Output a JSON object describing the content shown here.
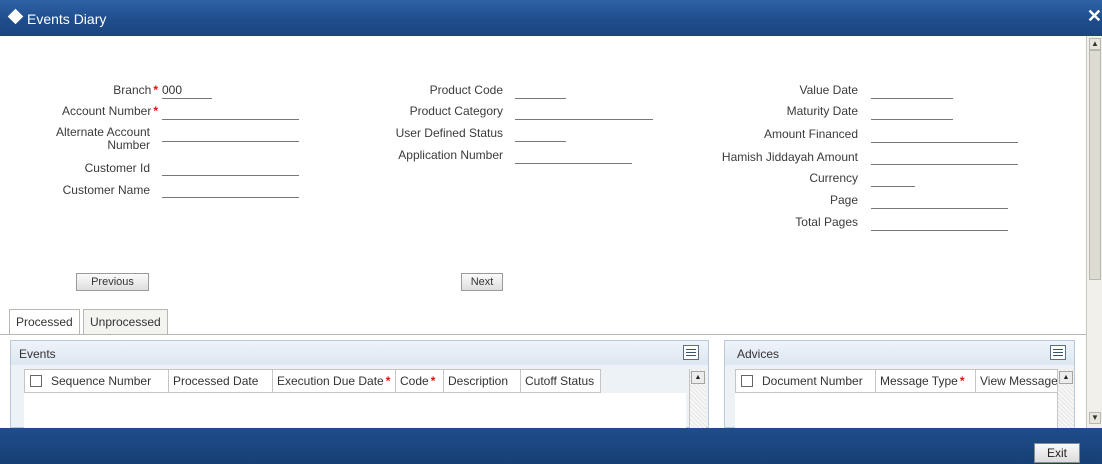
{
  "window": {
    "title": "Events Diary",
    "close_glyph": "✕"
  },
  "form": {
    "branch": {
      "label": "Branch",
      "required": "*",
      "value": "000"
    },
    "account_number": {
      "label": "Account Number",
      "required": "*",
      "value": ""
    },
    "alternate_account_number": {
      "label": "Alternate Account Number",
      "value": ""
    },
    "customer_id": {
      "label": "Customer Id",
      "value": ""
    },
    "customer_name": {
      "label": "Customer Name",
      "value": ""
    },
    "product_code": {
      "label": "Product Code",
      "value": ""
    },
    "product_category": {
      "label": "Product Category",
      "value": ""
    },
    "user_defined_status": {
      "label": "User Defined Status",
      "value": ""
    },
    "application_number": {
      "label": "Application Number",
      "value": ""
    },
    "value_date": {
      "label": "Value Date",
      "value": ""
    },
    "maturity_date": {
      "label": "Maturity Date",
      "value": ""
    },
    "amount_financed": {
      "label": "Amount Financed",
      "value": ""
    },
    "hamish_jiddayah_amount": {
      "label": "Hamish Jiddayah Amount",
      "value": ""
    },
    "currency": {
      "label": "Currency",
      "value": ""
    },
    "page": {
      "label": "Page",
      "value": ""
    },
    "total_pages": {
      "label": "Total Pages",
      "value": ""
    }
  },
  "buttons": {
    "previous": "Previous",
    "next": "Next",
    "exit": "Exit"
  },
  "tabs": [
    {
      "label": "Processed",
      "active": true
    },
    {
      "label": "Unprocessed",
      "active": false
    }
  ],
  "events_grid": {
    "title": "Events",
    "columns": [
      "Sequence Number",
      "Processed Date",
      "Execution Due Date",
      "Code",
      "Description",
      "Cutoff Status"
    ],
    "required_marker": "*",
    "icon": "grid-settings-icon"
  },
  "advices_grid": {
    "title": "Advices",
    "columns": [
      "Document Number",
      "Message Type",
      "View Message"
    ],
    "required_marker": "*",
    "icon": "grid-settings-icon"
  },
  "colors": {
    "titlebar": "#1f4d8c",
    "required": "#dd1111",
    "panel_bg": "#edf2f7"
  }
}
